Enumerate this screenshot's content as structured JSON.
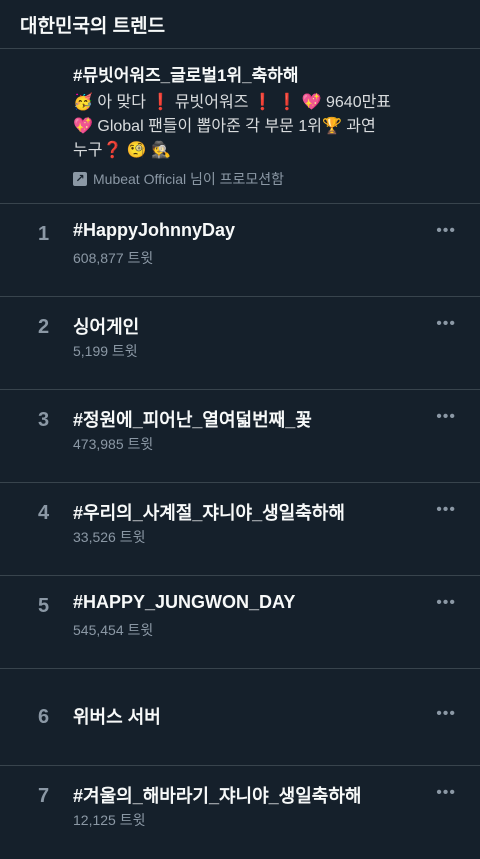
{
  "header": {
    "title": "대한민국의 트렌드"
  },
  "promo": {
    "title": "#뮤빗어워즈_글로벌1위_축하해",
    "body_line1_a": "🥳 아 맞다",
    "body_line1_b": "❗",
    "body_line1_c": " 뮤빗어워즈",
    "body_line1_d": "❗ ❗",
    "body_line1_e": " 💖 9640만표",
    "body_line2": "💖 Global 팬들이 뽑아준 각 부문 1위🏆 과연",
    "body_line3": "누구❓ 🧐  🕵",
    "promoted_text": "Mubeat Official 님이 프로모션함",
    "promoted_icon": "↗"
  },
  "trends": [
    {
      "rank": "1",
      "name": "#HappyJohnnyDay",
      "count": "608,877 트윗"
    },
    {
      "rank": "2",
      "name": "싱어게인",
      "count": "5,199 트윗"
    },
    {
      "rank": "3",
      "name": "#정원에_피어난_열여덟번째_꽃",
      "count": "473,985 트윗"
    },
    {
      "rank": "4",
      "name": "#우리의_사계절_쟈니야_생일축하해",
      "count": "33,526 트윗"
    },
    {
      "rank": "5",
      "name": "#HAPPY_JUNGWON_DAY",
      "count": "545,454 트윗"
    },
    {
      "rank": "6",
      "name": "위버스 서버",
      "count": ""
    },
    {
      "rank": "7",
      "name": "#겨울의_해바라기_쟈니야_생일축하해",
      "count": "12,125 트윗"
    }
  ],
  "more_label": "•••"
}
